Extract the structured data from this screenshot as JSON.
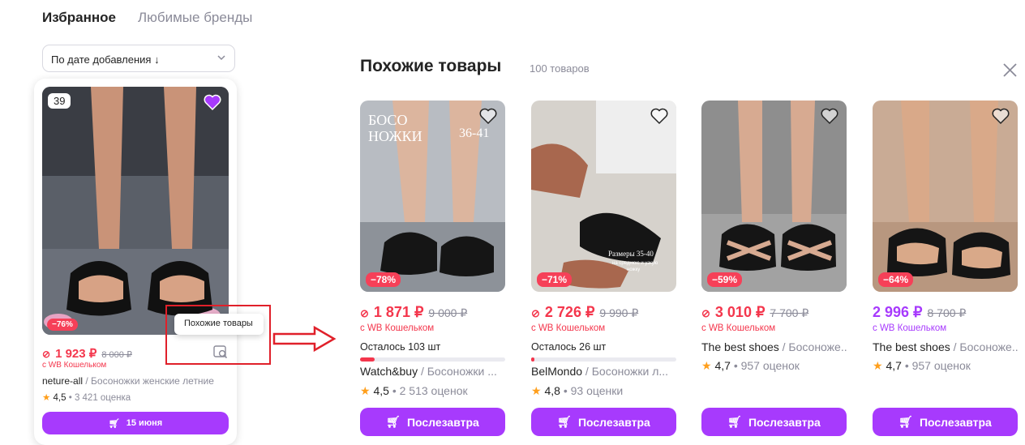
{
  "tabs": {
    "favorites": "Избранное",
    "brands": "Любимые бренды"
  },
  "sort": {
    "label": "По дате добавления ↓"
  },
  "fav_card": {
    "size_badge": "39",
    "discount": "−76%",
    "price": "1 923 ₽",
    "old_price": "8 000 ₽",
    "wallet": "с WB Кошельком",
    "brand": "neture-all",
    "name": " / Босоножки женские летние",
    "rating": "4,5",
    "reviews": "• 3 421 оценка",
    "button": "15 июня",
    "tooltip": "Похожие товары"
  },
  "similar": {
    "title": "Похожие товары",
    "count": "100 товаров",
    "products": [
      {
        "discount": "−78%",
        "price": "1 871 ₽",
        "old_price": "9 000 ₽",
        "wallet": "с WB Кошельком",
        "stock": "Осталось 103 шт",
        "stock_fraction": 0.1,
        "brand": "Watch&buy",
        "name": " / Босоножки ...",
        "rating": "4,5",
        "reviews": "• 2 513 оценок",
        "button": "Послезавтра",
        "overlay1": "БОСО",
        "overlay2": "НОЖКИ",
        "overlay3": "36-41"
      },
      {
        "discount": "−71%",
        "price": "2 726 ₽",
        "old_price": "9 990 ₽",
        "wallet": "с WB Кошельком",
        "stock": "Осталось 26 шт",
        "stock_fraction": 0.02,
        "brand": "BelMondo",
        "name": " / Босоножки л...",
        "rating": "4,8",
        "reviews": "• 93 оценки",
        "button": "Послезавтра",
        "overlay1": "Размеры 35-40",
        "overlay2": "на среднюю и узкую",
        "overlay3": "ножку"
      },
      {
        "discount": "−59%",
        "price": "3 010 ₽",
        "old_price": "7 700 ₽",
        "wallet": "с WB Кошельком",
        "brand": "The best shoes",
        "name": " / Босоноже...",
        "rating": "4,7",
        "reviews": "• 957 оценок",
        "button": "Послезавтра"
      },
      {
        "discount": "−64%",
        "price": "2 996 ₽",
        "old_price": "8 700 ₽",
        "wallet": "с WB Кошельком",
        "brand": "The best shoes",
        "name": " / Босоноже...",
        "rating": "4,7",
        "reviews": "• 957 оценок",
        "button": "Послезавтра"
      }
    ]
  },
  "colors": {
    "accent": "#a73afd",
    "discount": "#f4364c",
    "highlight_box": "#e0202a"
  }
}
